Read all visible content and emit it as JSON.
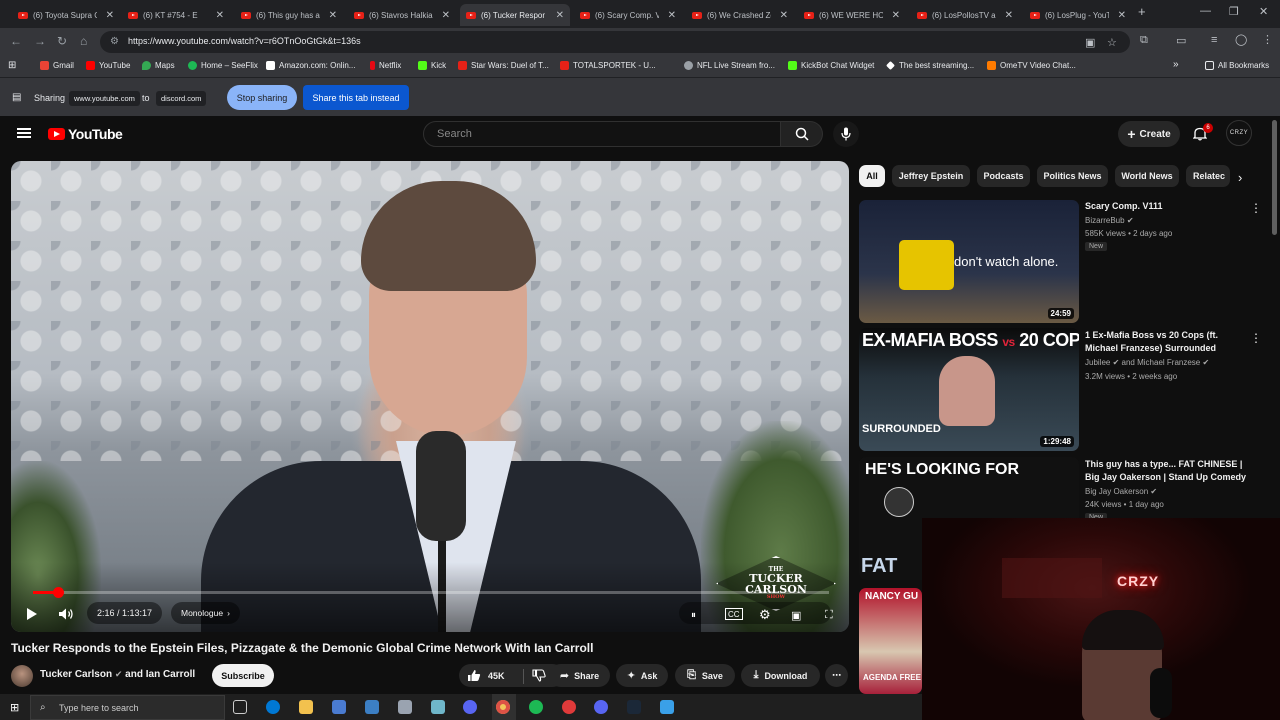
{
  "tabs": [
    {
      "title": "(6) Toyota Supra C"
    },
    {
      "title": "(6) KT #754 - E"
    },
    {
      "title": "(6) This guy has a"
    },
    {
      "title": "(6) Stavros Halkias"
    },
    {
      "title": "(6) Tucker Respon"
    },
    {
      "title": "(6) Scary Comp. V"
    },
    {
      "title": "(6) We Crashed Zo"
    },
    {
      "title": "(6) WE WERE HOI"
    },
    {
      "title": "(6) LosPollosTV an"
    },
    {
      "title": "(6) LosPlug - YouT"
    }
  ],
  "address": {
    "url": "https://www.youtube.com/watch?v=r6OTnOoGtGk&t=136s"
  },
  "bookmarks": [
    {
      "label": "Gmail",
      "color": "#ea4335"
    },
    {
      "label": "YouTube",
      "color": "#ff0000"
    },
    {
      "label": "Maps",
      "color": "#34a853"
    },
    {
      "label": "Home – SeeFlix",
      "color": "#1db954"
    },
    {
      "label": "Amazon.com: Onlin...",
      "color": "#ffffff"
    },
    {
      "label": "Netflix",
      "color": "#e50914"
    },
    {
      "label": "Kick",
      "color": "#53fc18"
    },
    {
      "label": "Star Wars: Duel of T...",
      "color": "#e62117"
    },
    {
      "label": "TOTALSPORTEK - U...",
      "color": "#e62117"
    },
    {
      "label": "NFL Live Stream fro...",
      "color": "#9aa0a6"
    },
    {
      "label": "KickBot Chat Widget",
      "color": "#53fc18"
    },
    {
      "label": "The best streaming...",
      "color": "#ffffff"
    },
    {
      "label": "OmeTV Video Chat...",
      "color": "#ff7b00"
    }
  ],
  "all_bookmarks": "All Bookmarks",
  "sharing": {
    "label": "Sharing",
    "from": "www.youtube.com",
    "to_word": "to",
    "target": "discord.com",
    "stop": "Stop sharing",
    "share_this": "Share this tab instead"
  },
  "yt": {
    "logo": "YouTube",
    "search_placeholder": "Search",
    "create": "Create",
    "notif_count": "6",
    "avatar_text": "CRZY"
  },
  "video": {
    "current_time": "2:16",
    "duration": "1:13:17",
    "time_display": "2:16 / 1:13:17",
    "chapter": "Monologue",
    "progress": 0.031,
    "watermark_line1": "THE",
    "watermark_line2": "TUCKER",
    "watermark_line3": "CARLSON",
    "watermark_line4": "SHOW",
    "title": "Tucker Responds to the Epstein Files, Pizzagate & the Demonic Global Crime Network With Ian Carroll",
    "channel": "Tucker Carlson",
    "channel_collab": "and Ian Carroll",
    "subscribe": "Subscribe",
    "likes": "45K",
    "share": "Share",
    "ask": "Ask",
    "save": "Save",
    "download": "Download"
  },
  "chips": [
    "All",
    "Jeffrey Epstein",
    "Podcasts",
    "Politics News",
    "World News",
    "Relatec"
  ],
  "recommendations": [
    {
      "title": "Scary Comp. V111",
      "channel": "BizarreBub",
      "meta": "585K views • 2 days ago",
      "badge": "New",
      "duration": "24:59",
      "overlay": "don't watch alone."
    },
    {
      "title": "1 Ex-Mafia Boss vs 20 Cops (ft. Michael Franzese) Surrounded",
      "channel": "Jubilee",
      "channel2": "and Michael Franzese",
      "meta": "3.2M views • 2 weeks ago",
      "duration": "1:29:48",
      "overlay": "EX-MAFIA BOSS",
      "overlay_vs": "vs",
      "overlay_cops": "20 COPS",
      "overlay_tag": "SURROUNDED"
    },
    {
      "title": "This guy has a type... FAT CHINESE | Big Jay Oakerson | Stand Up Comedy",
      "channel": "Big Jay Oakerson",
      "meta": "24K views • 1 day ago",
      "badge": "New",
      "overlay": "HE'S LOOKING FOR",
      "overlay_bottom": "FAT"
    },
    {
      "overlay": "NANCY GU",
      "overlay_bottom": "AGENDA FREE"
    }
  ],
  "webcam": {
    "neon": "CRZY"
  },
  "taskbar": {
    "search_placeholder": "Type here to search"
  }
}
